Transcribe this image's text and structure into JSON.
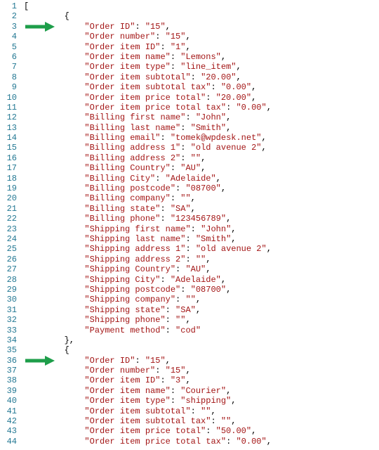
{
  "line_count": 44,
  "indent": {
    "key": "            ",
    "obj_open": "        {",
    "obj_close": "        },"
  },
  "arrows": [
    {
      "line": 3
    },
    {
      "line": 36
    }
  ],
  "lines": [
    {
      "n": 1,
      "raw": "["
    },
    {
      "n": 2,
      "type": "obj_open"
    },
    {
      "n": 3,
      "type": "kv",
      "key": "Order ID",
      "val": "15",
      "comma": true
    },
    {
      "n": 4,
      "type": "kv",
      "key": "Order number",
      "val": "15",
      "comma": true
    },
    {
      "n": 5,
      "type": "kv",
      "key": "Order item ID",
      "val": "1",
      "comma": true
    },
    {
      "n": 6,
      "type": "kv",
      "key": "Order item name",
      "val": "Lemons",
      "comma": true
    },
    {
      "n": 7,
      "type": "kv",
      "key": "Order item type",
      "val": "line_item",
      "comma": true
    },
    {
      "n": 8,
      "type": "kv",
      "key": "Order item subtotal",
      "val": "20.00",
      "comma": true
    },
    {
      "n": 9,
      "type": "kv",
      "key": "Order item subtotal tax",
      "val": "0.00",
      "comma": true
    },
    {
      "n": 10,
      "type": "kv",
      "key": "Order item price total",
      "val": "20.00",
      "comma": true
    },
    {
      "n": 11,
      "type": "kv",
      "key": "Order item price total tax",
      "val": "0.00",
      "comma": true
    },
    {
      "n": 12,
      "type": "kv",
      "key": "Billing first name",
      "val": "John",
      "comma": true
    },
    {
      "n": 13,
      "type": "kv",
      "key": "Billing last name",
      "val": "Smith",
      "comma": true
    },
    {
      "n": 14,
      "type": "kv",
      "key": "Billing email",
      "val": "tomek@wpdesk.net",
      "comma": true
    },
    {
      "n": 15,
      "type": "kv",
      "key": "Billing address 1",
      "val": "old avenue 2",
      "comma": true
    },
    {
      "n": 16,
      "type": "kv",
      "key": "Billing address 2",
      "val": "",
      "comma": true
    },
    {
      "n": 17,
      "type": "kv",
      "key": "Billing Country",
      "val": "AU",
      "comma": true
    },
    {
      "n": 18,
      "type": "kv",
      "key": "Billing City",
      "val": "Adelaide",
      "comma": true
    },
    {
      "n": 19,
      "type": "kv",
      "key": "Billing postcode",
      "val": "08700",
      "comma": true
    },
    {
      "n": 20,
      "type": "kv",
      "key": "Billing company",
      "val": "",
      "comma": true
    },
    {
      "n": 21,
      "type": "kv",
      "key": "Billing state",
      "val": "SA",
      "comma": true
    },
    {
      "n": 22,
      "type": "kv",
      "key": "Billing phone",
      "val": "123456789",
      "comma": true
    },
    {
      "n": 23,
      "type": "kv",
      "key": "Shipping first name",
      "val": "John",
      "comma": true
    },
    {
      "n": 24,
      "type": "kv",
      "key": "Shipping last name",
      "val": "Smith",
      "comma": true
    },
    {
      "n": 25,
      "type": "kv",
      "key": "Shipping address 1",
      "val": "old avenue 2",
      "comma": true
    },
    {
      "n": 26,
      "type": "kv",
      "key": "Shipping address 2",
      "val": "",
      "comma": true
    },
    {
      "n": 27,
      "type": "kv",
      "key": "Shipping Country",
      "val": "AU",
      "comma": true
    },
    {
      "n": 28,
      "type": "kv",
      "key": "Shipping City",
      "val": "Adelaide",
      "comma": true
    },
    {
      "n": 29,
      "type": "kv",
      "key": "Shipping postcode",
      "val": "08700",
      "comma": true
    },
    {
      "n": 30,
      "type": "kv",
      "key": "Shipping company",
      "val": "",
      "comma": true
    },
    {
      "n": 31,
      "type": "kv",
      "key": "Shipping state",
      "val": "SA",
      "comma": true
    },
    {
      "n": 32,
      "type": "kv",
      "key": "Shipping phone",
      "val": "",
      "comma": true
    },
    {
      "n": 33,
      "type": "kv",
      "key": "Payment method",
      "val": "cod",
      "comma": false
    },
    {
      "n": 34,
      "type": "obj_close"
    },
    {
      "n": 35,
      "type": "obj_open"
    },
    {
      "n": 36,
      "type": "kv",
      "key": "Order ID",
      "val": "15",
      "comma": true
    },
    {
      "n": 37,
      "type": "kv",
      "key": "Order number",
      "val": "15",
      "comma": true
    },
    {
      "n": 38,
      "type": "kv",
      "key": "Order item ID",
      "val": "3",
      "comma": true
    },
    {
      "n": 39,
      "type": "kv",
      "key": "Order item name",
      "val": "Courier",
      "comma": true
    },
    {
      "n": 40,
      "type": "kv",
      "key": "Order item type",
      "val": "shipping",
      "comma": true
    },
    {
      "n": 41,
      "type": "kv",
      "key": "Order item subtotal",
      "val": "",
      "comma": true
    },
    {
      "n": 42,
      "type": "kv",
      "key": "Order item subtotal tax",
      "val": "",
      "comma": true
    },
    {
      "n": 43,
      "type": "kv",
      "key": "Order item price total",
      "val": "50.00",
      "comma": true
    },
    {
      "n": 44,
      "type": "kv",
      "key": "Order item price total tax",
      "val": "0.00",
      "comma": true
    }
  ]
}
